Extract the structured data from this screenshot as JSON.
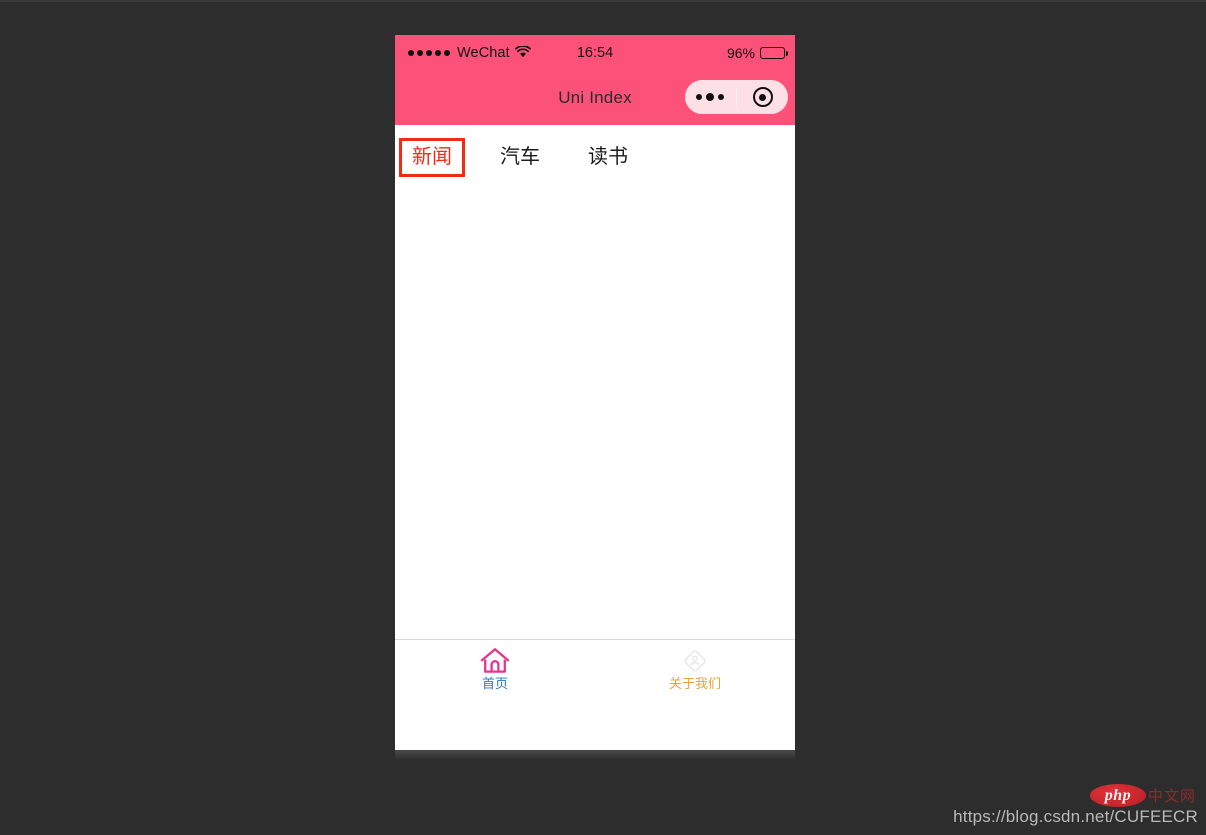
{
  "background_color": "#2d2d2d",
  "device": {
    "status_bar": {
      "background_color": "#fc5178",
      "signal_dots": 5,
      "carrier": "WeChat",
      "wifi_icon": "wifi-icon",
      "time": "16:54",
      "battery_percent": "96%",
      "battery_icon": "battery-full-icon"
    },
    "nav_bar": {
      "title": "Uni Index",
      "background_color": "#fc5178",
      "capsule": {
        "menu_icon": "ellipsis-icon",
        "close_icon": "target-circle-icon"
      }
    },
    "content": {
      "tabs": [
        {
          "label": "新闻",
          "active": true,
          "color": "#f22b16"
        },
        {
          "label": "汽车",
          "active": false,
          "color": "#1b1b1b"
        },
        {
          "label": "读书",
          "active": false,
          "color": "#1b1b1b"
        }
      ]
    },
    "tabbar": {
      "items": [
        {
          "label": "首页",
          "icon": "home-icon",
          "icon_color": "#e8348f",
          "label_color": "#2477d6",
          "active": true
        },
        {
          "label": "关于我们",
          "icon": "user-diamond-icon",
          "icon_color": "#e2e2e2",
          "label_color": "#e8a13c",
          "active": false
        }
      ]
    }
  },
  "watermark": {
    "url": "https://blog.csdn.net/CUFEECR",
    "badge_text": "php",
    "badge_suffix": "中文网"
  }
}
